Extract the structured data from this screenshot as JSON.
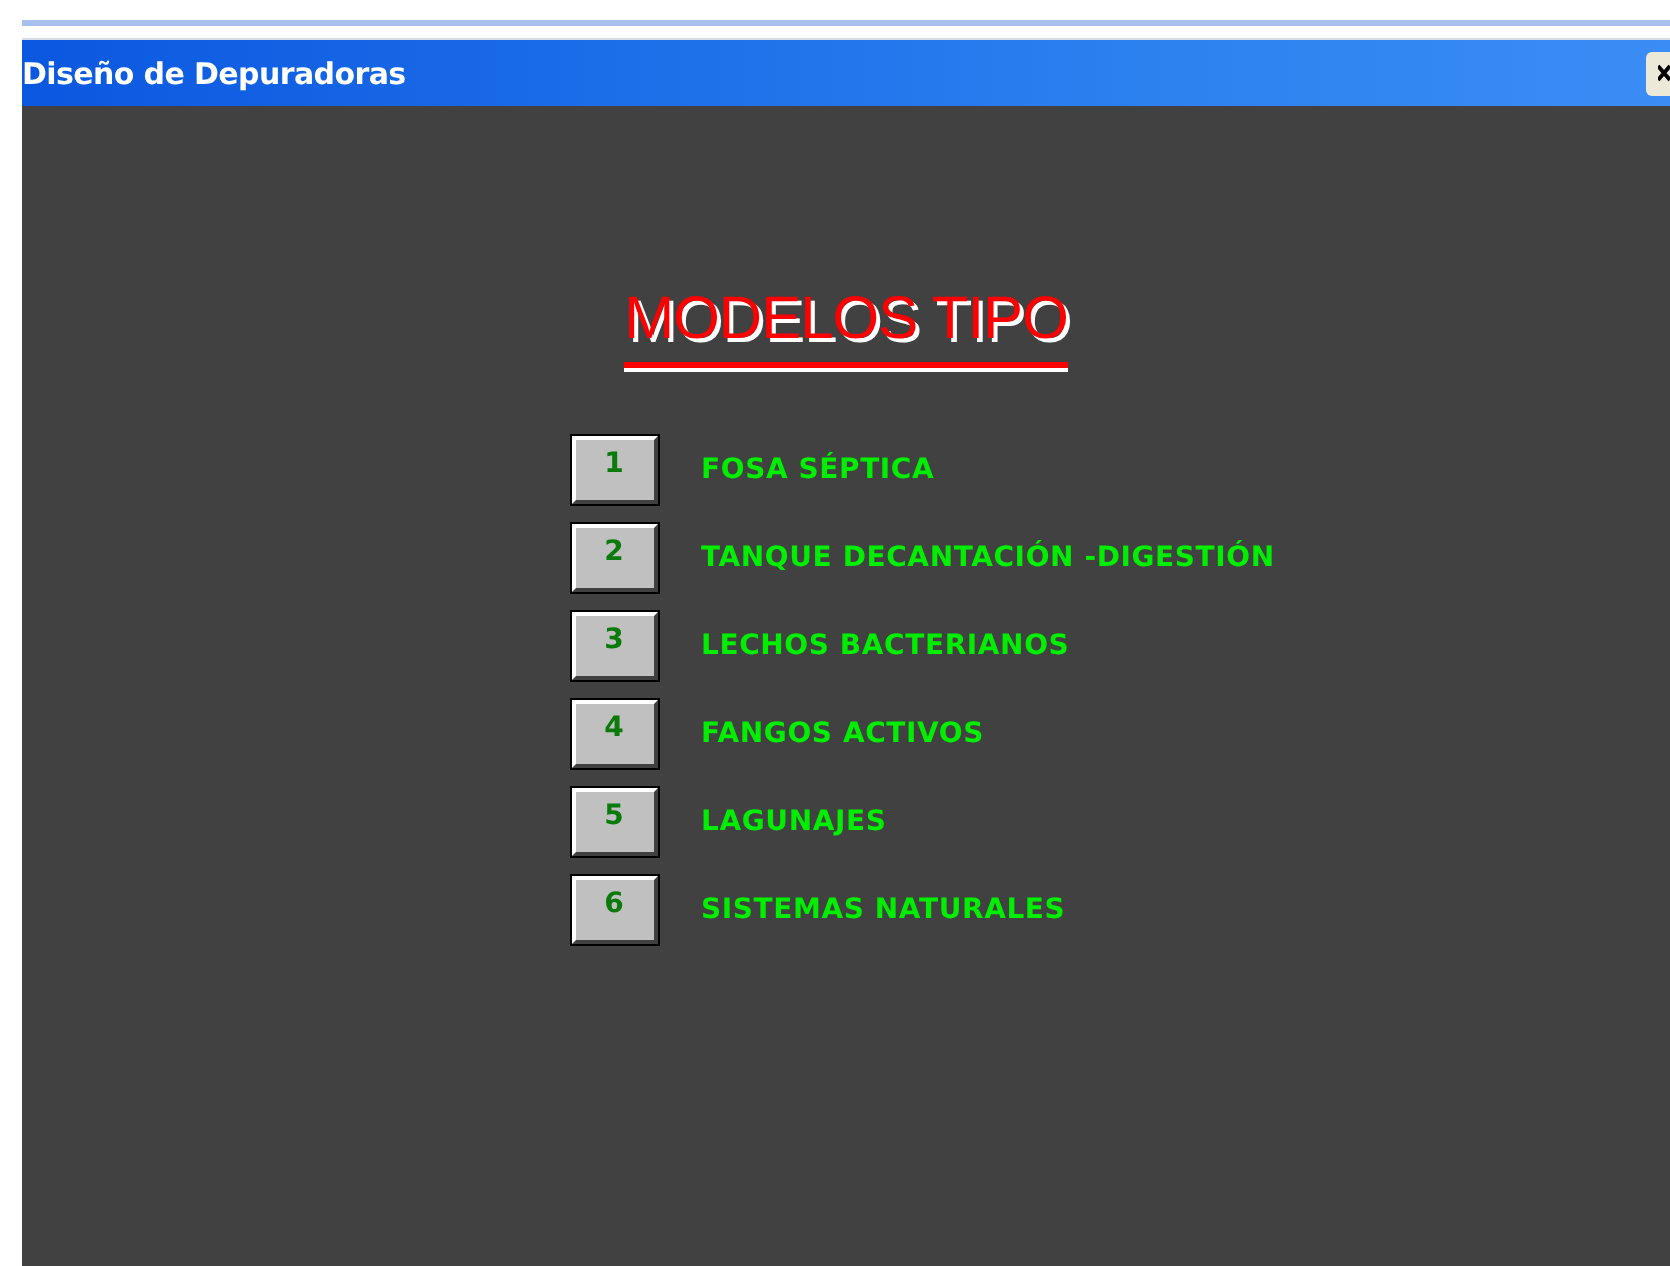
{
  "window": {
    "title": "Diseño de Depuradoras"
  },
  "heading": "MODELOS TIPO",
  "models": [
    {
      "number": "1",
      "label": "FOSA SÉPTICA"
    },
    {
      "number": "2",
      "label": "TANQUE DECANTACIÓN -DIGESTIÓN"
    },
    {
      "number": "3",
      "label": "LECHOS BACTERIANOS"
    },
    {
      "number": "4",
      "label": "FANGOS ACTIVOS"
    },
    {
      "number": "5",
      "label": "LAGUNAJES"
    },
    {
      "number": "6",
      "label": "SISTEMAS NATURALES"
    }
  ]
}
